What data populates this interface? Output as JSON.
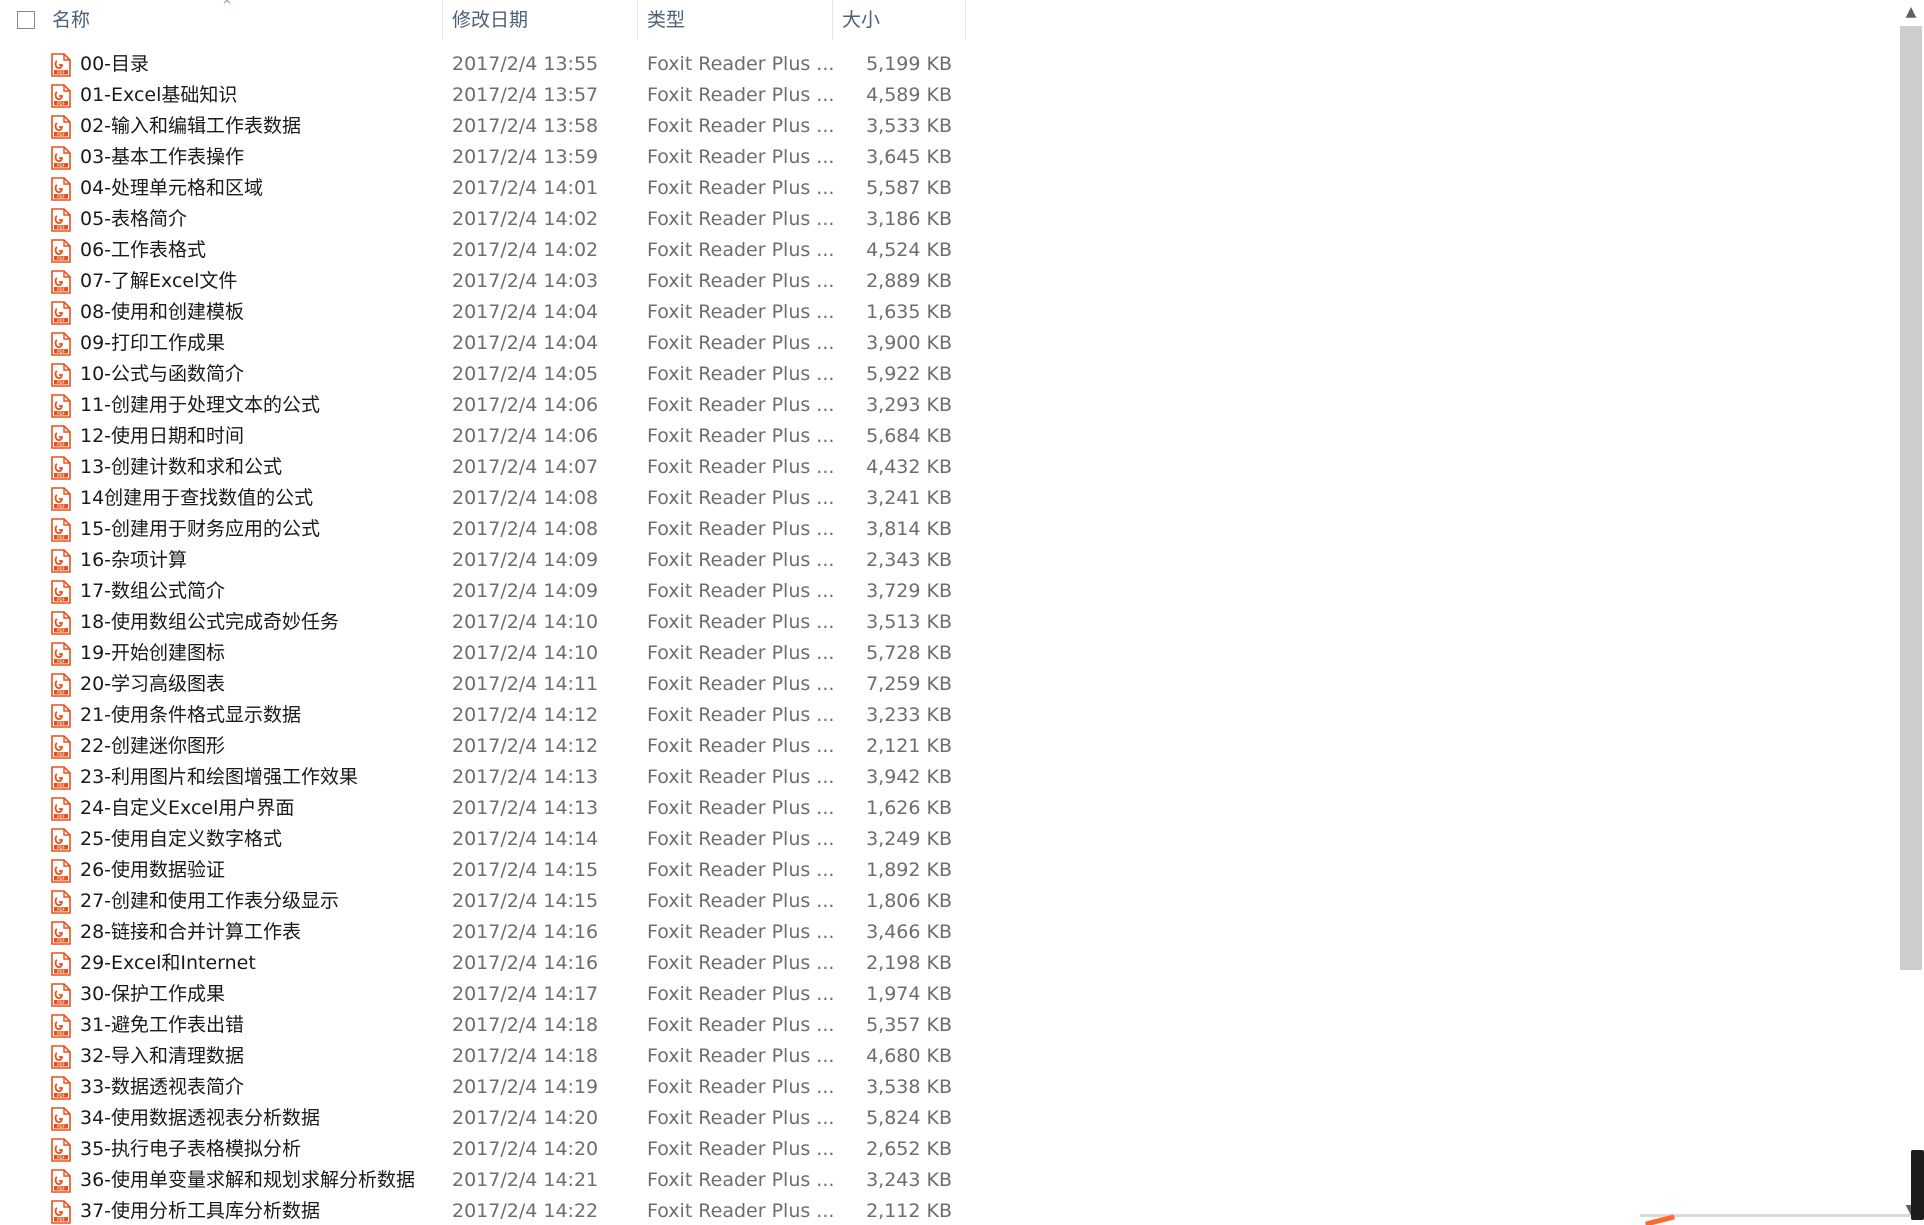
{
  "header": {
    "name_label": "名称",
    "date_label": "修改日期",
    "type_label": "类型",
    "size_label": "大小",
    "sort_indicator": "^"
  },
  "icon": "pdf-file-icon",
  "accent_color": "#e8501b",
  "files": [
    {
      "name": "00-目录",
      "date": "2017/2/4 13:55",
      "type": "Foxit Reader Plus ...",
      "size": "5,199 KB"
    },
    {
      "name": "01-Excel基础知识",
      "date": "2017/2/4 13:57",
      "type": "Foxit Reader Plus ...",
      "size": "4,589 KB"
    },
    {
      "name": "02-输入和编辑工作表数据",
      "date": "2017/2/4 13:58",
      "type": "Foxit Reader Plus ...",
      "size": "3,533 KB"
    },
    {
      "name": "03-基本工作表操作",
      "date": "2017/2/4 13:59",
      "type": "Foxit Reader Plus ...",
      "size": "3,645 KB"
    },
    {
      "name": "04-处理单元格和区域",
      "date": "2017/2/4 14:01",
      "type": "Foxit Reader Plus ...",
      "size": "5,587 KB"
    },
    {
      "name": "05-表格简介",
      "date": "2017/2/4 14:02",
      "type": "Foxit Reader Plus ...",
      "size": "3,186 KB"
    },
    {
      "name": "06-工作表格式",
      "date": "2017/2/4 14:02",
      "type": "Foxit Reader Plus ...",
      "size": "4,524 KB"
    },
    {
      "name": "07-了解Excel文件",
      "date": "2017/2/4 14:03",
      "type": "Foxit Reader Plus ...",
      "size": "2,889 KB"
    },
    {
      "name": "08-使用和创建模板",
      "date": "2017/2/4 14:04",
      "type": "Foxit Reader Plus ...",
      "size": "1,635 KB"
    },
    {
      "name": "09-打印工作成果",
      "date": "2017/2/4 14:04",
      "type": "Foxit Reader Plus ...",
      "size": "3,900 KB"
    },
    {
      "name": "10-公式与函数简介",
      "date": "2017/2/4 14:05",
      "type": "Foxit Reader Plus ...",
      "size": "5,922 KB"
    },
    {
      "name": "11-创建用于处理文本的公式",
      "date": "2017/2/4 14:06",
      "type": "Foxit Reader Plus ...",
      "size": "3,293 KB"
    },
    {
      "name": "12-使用日期和时间",
      "date": "2017/2/4 14:06",
      "type": "Foxit Reader Plus ...",
      "size": "5,684 KB"
    },
    {
      "name": "13-创建计数和求和公式",
      "date": "2017/2/4 14:07",
      "type": "Foxit Reader Plus ...",
      "size": "4,432 KB"
    },
    {
      "name": "14创建用于查找数值的公式",
      "date": "2017/2/4 14:08",
      "type": "Foxit Reader Plus ...",
      "size": "3,241 KB"
    },
    {
      "name": "15-创建用于财务应用的公式",
      "date": "2017/2/4 14:08",
      "type": "Foxit Reader Plus ...",
      "size": "3,814 KB"
    },
    {
      "name": "16-杂项计算",
      "date": "2017/2/4 14:09",
      "type": "Foxit Reader Plus ...",
      "size": "2,343 KB"
    },
    {
      "name": "17-数组公式简介",
      "date": "2017/2/4 14:09",
      "type": "Foxit Reader Plus ...",
      "size": "3,729 KB"
    },
    {
      "name": "18-使用数组公式完成奇妙任务",
      "date": "2017/2/4 14:10",
      "type": "Foxit Reader Plus ...",
      "size": "3,513 KB"
    },
    {
      "name": "19-开始创建图标",
      "date": "2017/2/4 14:10",
      "type": "Foxit Reader Plus ...",
      "size": "5,728 KB"
    },
    {
      "name": "20-学习高级图表",
      "date": "2017/2/4 14:11",
      "type": "Foxit Reader Plus ...",
      "size": "7,259 KB"
    },
    {
      "name": "21-使用条件格式显示数据",
      "date": "2017/2/4 14:12",
      "type": "Foxit Reader Plus ...",
      "size": "3,233 KB"
    },
    {
      "name": "22-创建迷你图形",
      "date": "2017/2/4 14:12",
      "type": "Foxit Reader Plus ...",
      "size": "2,121 KB"
    },
    {
      "name": "23-利用图片和绘图增强工作效果",
      "date": "2017/2/4 14:13",
      "type": "Foxit Reader Plus ...",
      "size": "3,942 KB"
    },
    {
      "name": "24-自定义Excel用户界面",
      "date": "2017/2/4 14:13",
      "type": "Foxit Reader Plus ...",
      "size": "1,626 KB"
    },
    {
      "name": "25-使用自定义数字格式",
      "date": "2017/2/4 14:14",
      "type": "Foxit Reader Plus ...",
      "size": "3,249 KB"
    },
    {
      "name": "26-使用数据验证",
      "date": "2017/2/4 14:15",
      "type": "Foxit Reader Plus ...",
      "size": "1,892 KB"
    },
    {
      "name": "27-创建和使用工作表分级显示",
      "date": "2017/2/4 14:15",
      "type": "Foxit Reader Plus ...",
      "size": "1,806 KB"
    },
    {
      "name": "28-链接和合并计算工作表",
      "date": "2017/2/4 14:16",
      "type": "Foxit Reader Plus ...",
      "size": "3,466 KB"
    },
    {
      "name": "29-Excel和Internet",
      "date": "2017/2/4 14:16",
      "type": "Foxit Reader Plus ...",
      "size": "2,198 KB"
    },
    {
      "name": "30-保护工作成果",
      "date": "2017/2/4 14:17",
      "type": "Foxit Reader Plus ...",
      "size": "1,974 KB"
    },
    {
      "name": "31-避免工作表出错",
      "date": "2017/2/4 14:18",
      "type": "Foxit Reader Plus ...",
      "size": "5,357 KB"
    },
    {
      "name": "32-导入和清理数据",
      "date": "2017/2/4 14:18",
      "type": "Foxit Reader Plus ...",
      "size": "4,680 KB"
    },
    {
      "name": "33-数据透视表简介",
      "date": "2017/2/4 14:19",
      "type": "Foxit Reader Plus ...",
      "size": "3,538 KB"
    },
    {
      "name": "34-使用数据透视表分析数据",
      "date": "2017/2/4 14:20",
      "type": "Foxit Reader Plus ...",
      "size": "5,824 KB"
    },
    {
      "name": "35-执行电子表格模拟分析",
      "date": "2017/2/4 14:20",
      "type": "Foxit Reader Plus ...",
      "size": "2,652 KB"
    },
    {
      "name": "36-使用单变量求解和规划求解分析数据",
      "date": "2017/2/4 14:21",
      "type": "Foxit Reader Plus ...",
      "size": "3,243 KB"
    },
    {
      "name": "37-使用分析工具库分析数据",
      "date": "2017/2/4 14:22",
      "type": "Foxit Reader Plus ...",
      "size": "2,112 KB"
    }
  ],
  "scrollbar": {
    "up_icon": "chevron-up-icon",
    "down_icon": "chevron-down-icon"
  }
}
